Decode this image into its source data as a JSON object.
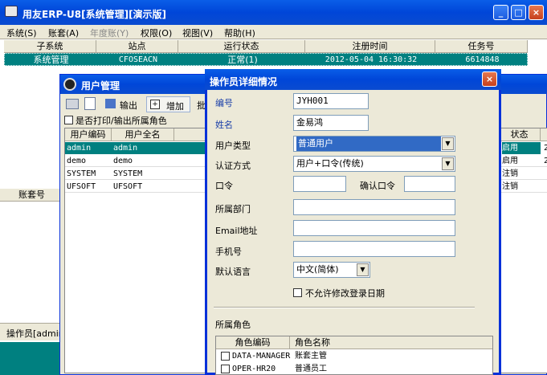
{
  "main_window": {
    "title": "用友ERP-U8[系统管理][演示版]",
    "menu": [
      "系统(S)",
      "账套(A)",
      "年度账(Y)",
      "权限(O)",
      "视图(V)",
      "帮助(H)"
    ],
    "columns": [
      "子系统",
      "站点",
      "运行状态",
      "注册时间",
      "任务号"
    ],
    "row": [
      "系统管理",
      "CFOSEACN",
      "正常(1)",
      "2012-05-04 16:30:32",
      "6614848"
    ],
    "section_label": "账套号",
    "status_text": "操作员[admin"
  },
  "user_window": {
    "title": "用户管理",
    "toolbar": {
      "output": "输出",
      "add": "增加",
      "batch": "批"
    },
    "print_roles_label": "是否打印/输出所属角色",
    "columns": [
      "用户编码",
      "用户全名",
      "状态"
    ],
    "rows": [
      {
        "code": "admin",
        "name": "admin",
        "status": "启用",
        "extra": "2"
      },
      {
        "code": "demo",
        "name": "demo",
        "status": "启用",
        "extra": "2"
      },
      {
        "code": "SYSTEM",
        "name": "SYSTEM",
        "status": "注销",
        "extra": ""
      },
      {
        "code": "UFSOFT",
        "name": "UFSOFT",
        "status": "注销",
        "extra": ""
      }
    ]
  },
  "detail_dialog": {
    "title": "操作员详细情况",
    "labels": {
      "code": "编号",
      "name": "姓名",
      "user_type": "用户类型",
      "auth_method": "认证方式",
      "password": "口令",
      "confirm_password": "确认口令",
      "department": "所属部门",
      "email": "Email地址",
      "phone": "手机号",
      "language": "默认语言",
      "no_modify_date": "不允许修改登录日期",
      "roles": "所属角色"
    },
    "values": {
      "code": "JYH001",
      "name": "金易鸿",
      "user_type": "普通用户",
      "auth_method": "用户+口令(传统)",
      "language": "中文(简体)"
    },
    "role_columns": [
      "角色编码",
      "角色名称"
    ],
    "roles": [
      {
        "code": "DATA-MANAGER",
        "name": "账套主管"
      },
      {
        "code": "OPER-HR20",
        "name": "普通员工"
      }
    ]
  }
}
